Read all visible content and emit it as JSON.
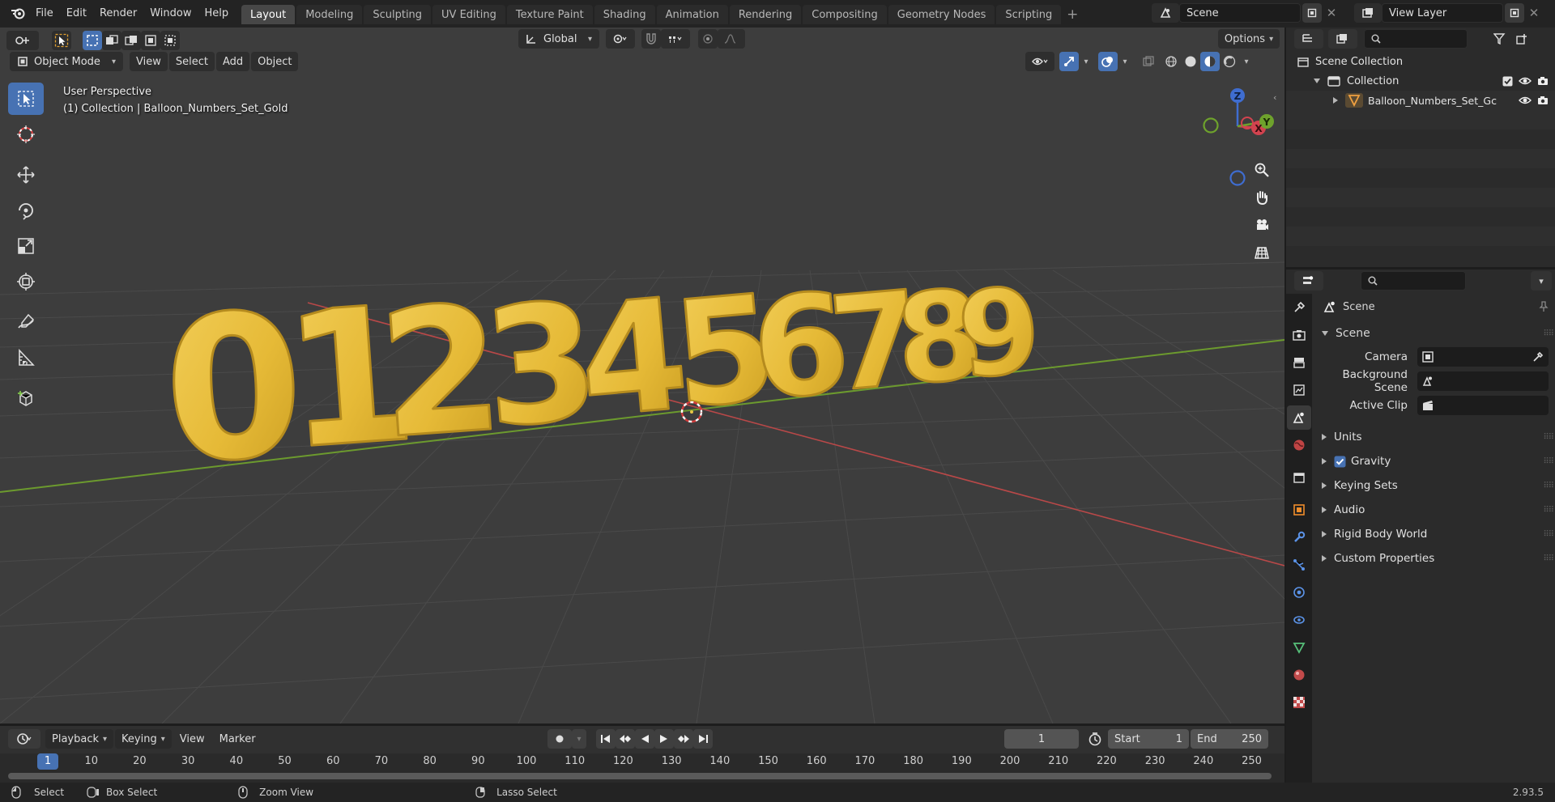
{
  "menu": {
    "items": [
      "File",
      "Edit",
      "Render",
      "Window",
      "Help"
    ]
  },
  "workspaces": [
    "Layout",
    "Modeling",
    "Sculpting",
    "UV Editing",
    "Texture Paint",
    "Shading",
    "Animation",
    "Rendering",
    "Compositing",
    "Geometry Nodes",
    "Scripting"
  ],
  "scene_field": "Scene",
  "view_layer_field": "View Layer",
  "viewport": {
    "mode": "Object Mode",
    "menus": [
      "View",
      "Select",
      "Add",
      "Object"
    ],
    "transform_orientation": "Global",
    "options_label": "Options",
    "overlay_title": "User Perspective",
    "overlay_subtitle": "(1) Collection | Balloon_Numbers_Set_Gold",
    "gizmo_axes": [
      "Z",
      "X",
      "Y"
    ],
    "balloon_digits": [
      "0",
      "1",
      "2",
      "3",
      "4",
      "5",
      "6",
      "7",
      "8",
      "9"
    ],
    "balloon_color": "#e9be3c",
    "x_axis_color": "#b84848",
    "y_axis_color": "#6c9a2e"
  },
  "timeline": {
    "menus": [
      "Playback",
      "Keying",
      "View",
      "Marker"
    ],
    "current_frame": "1",
    "start_label": "Start",
    "start_value": "1",
    "end_label": "End",
    "end_value": "250",
    "frame_ticks": [
      "1",
      "10",
      "20",
      "30",
      "40",
      "50",
      "60",
      "70",
      "80",
      "90",
      "100",
      "110",
      "120",
      "130",
      "140",
      "150",
      "160",
      "170",
      "180",
      "190",
      "200",
      "210",
      "220",
      "230",
      "240",
      "250"
    ]
  },
  "status": {
    "select": "Select",
    "box_select": "Box Select",
    "zoom_view": "Zoom View",
    "lasso_select": "Lasso Select",
    "version": "2.93.5"
  },
  "outliner": {
    "root": "Scene Collection",
    "collection": "Collection",
    "object": "Balloon_Numbers_Set_Gc"
  },
  "properties": {
    "context": "Scene",
    "panel_title": "Scene",
    "camera_label": "Camera",
    "background_scene_label": "Background Scene",
    "active_clip_label": "Active Clip",
    "subpanels": [
      "Units",
      "Gravity",
      "Keying Sets",
      "Audio",
      "Rigid Body World",
      "Custom Properties"
    ],
    "gravity_checked": true
  },
  "colors": {
    "accent": "#4772b3",
    "panel": "#2b2b2b",
    "viewport_bg": "#3d3d3d"
  }
}
